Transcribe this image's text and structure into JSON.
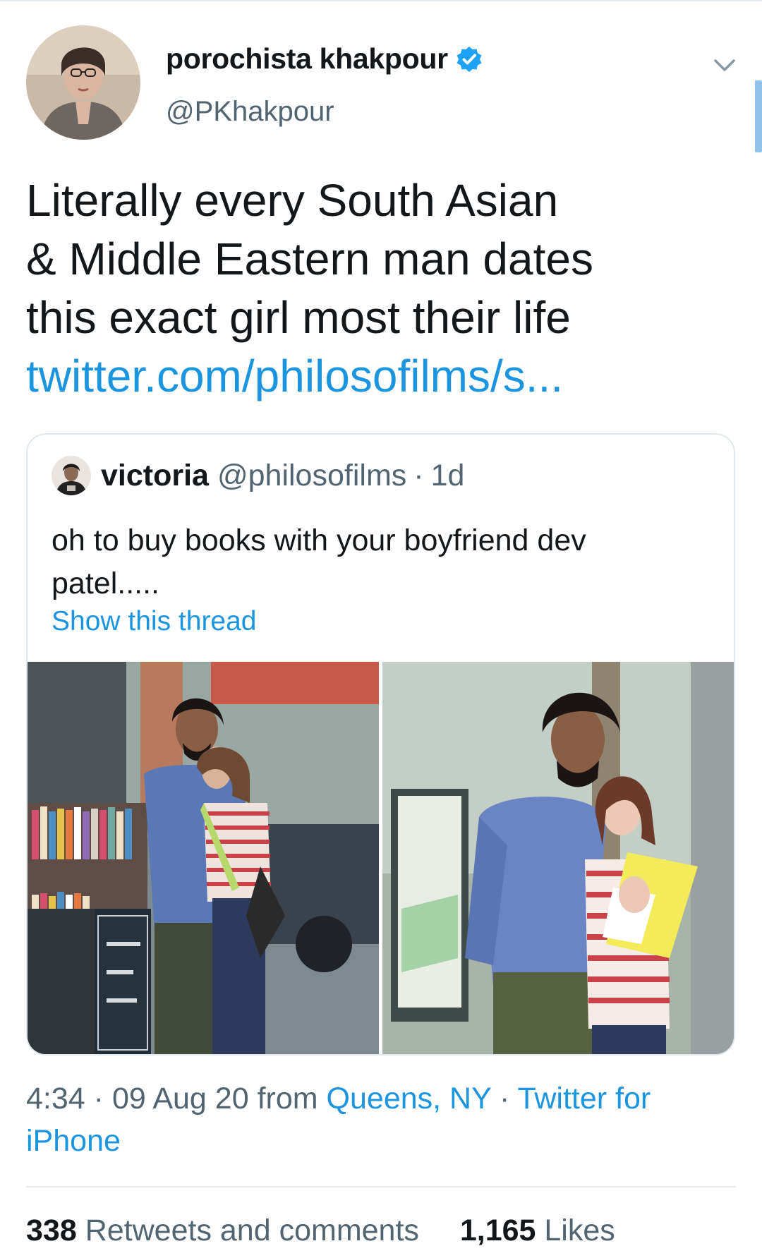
{
  "author": {
    "name": "porochista khakpour",
    "handle": "@PKhakpour",
    "verified": true
  },
  "tweet": {
    "lines": [
      "Literally every South Asian",
      "& Middle Eastern man dates",
      "this exact girl most their life"
    ],
    "link": "twitter.com/philosofilms/s..."
  },
  "quoted": {
    "name": "victoria",
    "handle": "@philosofilms",
    "separator": "·",
    "time": "1d",
    "text_lines": [
      "oh to buy books with your boyfriend dev",
      "patel....."
    ],
    "show_thread": "Show this thread",
    "media_count": 2
  },
  "meta": {
    "time": "4:34",
    "sep1": "·",
    "date": "09 Aug 20",
    "from_label": "from",
    "location": "Queens, NY",
    "sep2": "·",
    "client_line1": "Twitter for",
    "client_line2": "iPhone"
  },
  "stats": {
    "retweets_count": "338",
    "retweets_label": "Retweets and comments",
    "likes_count": "1,165",
    "likes_label": "Likes"
  },
  "colors": {
    "accent": "#1b95e0",
    "text": "#14171a",
    "secondary": "#536471",
    "border": "#e1e8ed",
    "verified": "#1da1f2"
  },
  "icons": [
    "verified-badge-icon",
    "chevron-down-icon"
  ]
}
